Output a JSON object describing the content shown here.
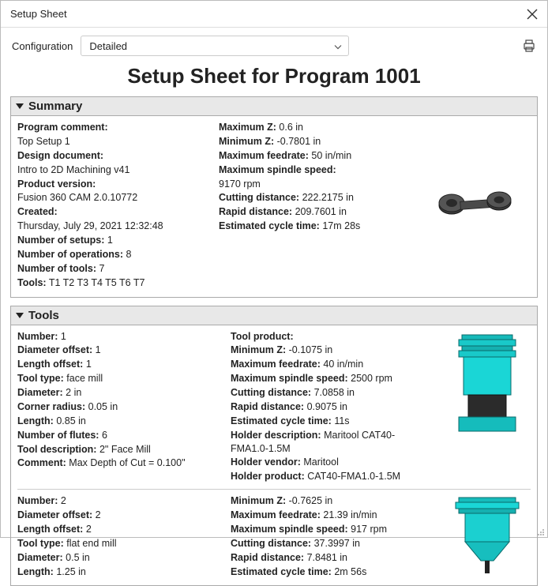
{
  "window": {
    "title": "Setup Sheet"
  },
  "toolbar": {
    "config_label": "Configuration",
    "config_value": "Detailed"
  },
  "main_title": "Setup Sheet for Program 1001",
  "sections": {
    "summary": {
      "title": "Summary",
      "left": {
        "program_comment_label": "Program comment:",
        "program_comment_value": "Top Setup 1",
        "design_doc_label": "Design document:",
        "design_doc_value": "Intro to 2D Machining v41",
        "product_version_label": "Product version:",
        "product_version_value": "Fusion 360 CAM 2.0.10772",
        "created_label": "Created:",
        "created_value": "Thursday, July 29, 2021 12:32:48",
        "num_setups_label": "Number of setups:",
        "num_setups_value": "1",
        "num_ops_label": "Number of operations:",
        "num_ops_value": "8",
        "num_tools_label": "Number of tools:",
        "num_tools_value": "7",
        "tools_label": "Tools:",
        "tools_value": "T1 T2 T3 T4 T5 T6 T7"
      },
      "right": {
        "max_z_label": "Maximum Z:",
        "max_z_value": "0.6 in",
        "min_z_label": "Minimum Z:",
        "min_z_value": "-0.7801 in",
        "max_feed_label": "Maximum feedrate:",
        "max_feed_value": "50 in/min",
        "max_spindle_label": "Maximum spindle speed:",
        "max_spindle_value": "9170 rpm",
        "cut_dist_label": "Cutting distance:",
        "cut_dist_value": "222.2175 in",
        "rapid_dist_label": "Rapid distance:",
        "rapid_dist_value": "209.7601 in",
        "cycle_label": "Estimated cycle time:",
        "cycle_value": "17m 28s"
      }
    },
    "tools": {
      "title": "Tools",
      "tool1": {
        "left": {
          "number_label": "Number:",
          "number_value": "1",
          "doff_label": "Diameter offset:",
          "doff_value": "1",
          "loff_label": "Length offset:",
          "loff_value": "1",
          "type_label": "Tool type:",
          "type_value": "face mill",
          "dia_label": "Diameter:",
          "dia_value": "2 in",
          "corner_label": "Corner radius:",
          "corner_value": "0.05 in",
          "len_label": "Length:",
          "len_value": "0.85 in",
          "flutes_label": "Number of flutes:",
          "flutes_value": "6",
          "desc_label": "Tool description:",
          "desc_value": "2\" Face Mill",
          "comment_label": "Comment:",
          "comment_value": "Max Depth of Cut = 0.100\""
        },
        "right": {
          "prod_label": "Tool product:",
          "prod_value": "",
          "minz_label": "Minimum Z:",
          "minz_value": "-0.1075 in",
          "maxfeed_label": "Maximum feedrate:",
          "maxfeed_value": "40 in/min",
          "maxspindle_label": "Maximum spindle speed:",
          "maxspindle_value": "2500 rpm",
          "cutdist_label": "Cutting distance:",
          "cutdist_value": "7.0858 in",
          "rapiddist_label": "Rapid distance:",
          "rapiddist_value": "0.9075 in",
          "cycle_label": "Estimated cycle time:",
          "cycle_value": "11s",
          "holder_desc_label": "Holder description:",
          "holder_desc_value": "Maritool CAT40-FMA1.0-1.5M",
          "holder_vendor_label": "Holder vendor:",
          "holder_vendor_value": "Maritool",
          "holder_prod_label": "Holder product:",
          "holder_prod_value": "CAT40-FMA1.0-1.5M"
        }
      },
      "tool2": {
        "left": {
          "number_label": "Number:",
          "number_value": "2",
          "doff_label": "Diameter offset:",
          "doff_value": "2",
          "loff_label": "Length offset:",
          "loff_value": "2",
          "type_label": "Tool type:",
          "type_value": "flat end mill",
          "dia_label": "Diameter:",
          "dia_value": "0.5 in",
          "len_label": "Length:",
          "len_value": "1.25 in"
        },
        "right": {
          "minz_label": "Minimum Z:",
          "minz_value": "-0.7625 in",
          "maxfeed_label": "Maximum feedrate:",
          "maxfeed_value": "21.39 in/min",
          "maxspindle_label": "Maximum spindle speed:",
          "maxspindle_value": "917 rpm",
          "cutdist_label": "Cutting distance:",
          "cutdist_value": "37.3997 in",
          "rapiddist_label": "Rapid distance:",
          "rapiddist_value": "7.8481 in",
          "cycle_label": "Estimated cycle time:",
          "cycle_value": "2m 56s"
        }
      }
    }
  }
}
